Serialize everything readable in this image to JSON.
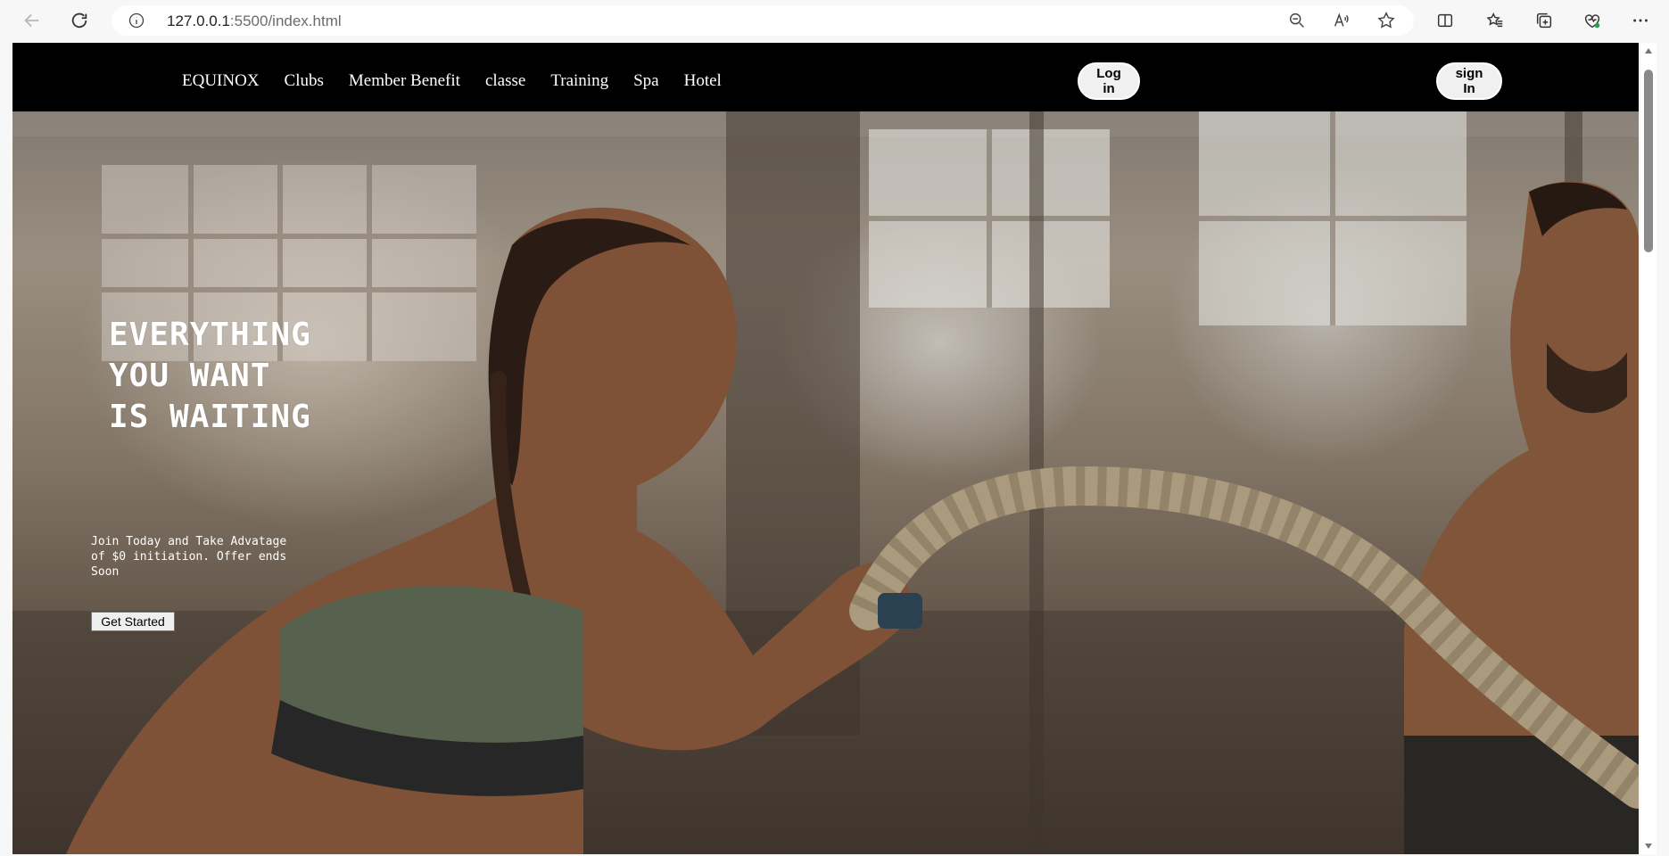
{
  "browser": {
    "url_host": "127.0.0.1",
    "url_path": ":5500/index.html",
    "icons": [
      "back-icon",
      "reload-icon",
      "info-icon",
      "zoom-out-icon",
      "read-aloud-icon",
      "favorite-star-icon",
      "split-screen-icon",
      "favorites-icon",
      "collections-icon",
      "browser-essentials-icon",
      "more-icon"
    ]
  },
  "nav": {
    "brand": "EQUINOX",
    "links": [
      "Clubs",
      "Member Benefit",
      "classe",
      "Training",
      "Spa",
      "Hotel"
    ],
    "login_label": "Log in",
    "signin_label": "sign In"
  },
  "hero": {
    "headline": [
      "EVERYTHING",
      "YOU WANT",
      "IS WAITING"
    ],
    "subtext": "Join Today and Take Advatage of $0 initiation. Offer ends Soon",
    "cta_label": "Get Started"
  },
  "colors": {
    "navbar_bg": "#000000",
    "nav_text": "#ffffff",
    "pill_bg": "#f0f0f0"
  }
}
